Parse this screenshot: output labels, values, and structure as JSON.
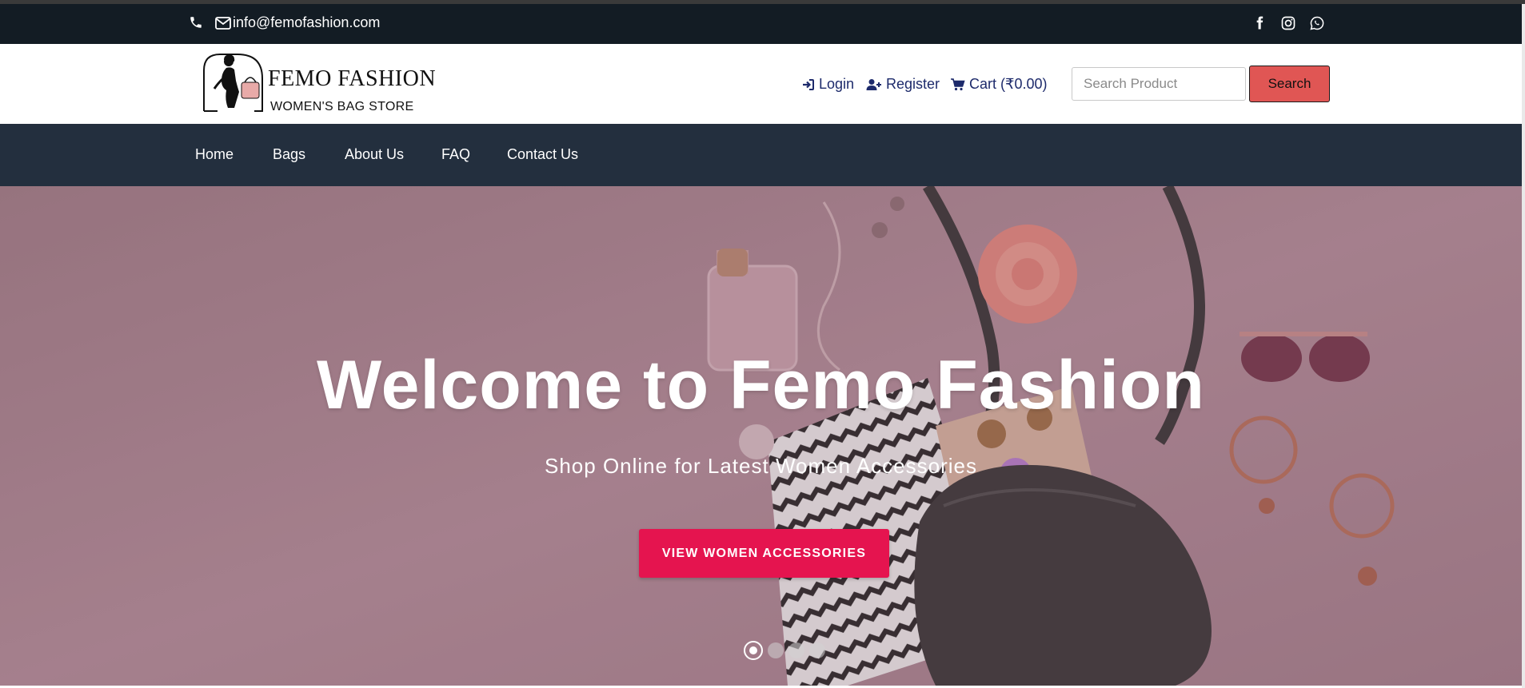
{
  "topbar": {
    "phone_icon": "phone-icon",
    "mail_icon": "envelope-icon",
    "email": "info@femofashion.com",
    "social": [
      "facebook-icon",
      "instagram-icon",
      "whatsapp-icon"
    ]
  },
  "header": {
    "brand": "FEMO FASHION",
    "tagline": "WOMEN'S BAG STORE",
    "login_label": "Login",
    "register_label": "Register",
    "cart_label": "Cart (₹0.00)",
    "search_placeholder": "Search Product",
    "search_button": "Search"
  },
  "nav": {
    "items": [
      "Home",
      "Bags",
      "About Us",
      "FAQ",
      "Contact Us"
    ]
  },
  "hero": {
    "title": "Welcome to Femo Fashion",
    "subtitle": "Shop Online for Latest Women Accessories",
    "cta": "VIEW WOMEN ACCESSORIES",
    "slide_count": 4,
    "active_slide": 1
  },
  "colors": {
    "topbar_bg": "#131c24",
    "nav_bg": "#232f3e",
    "link_color": "#1d2a6b",
    "search_button_bg": "#e05654",
    "cta_bg": "#e5144f",
    "hero_tint": "#a4828d"
  }
}
